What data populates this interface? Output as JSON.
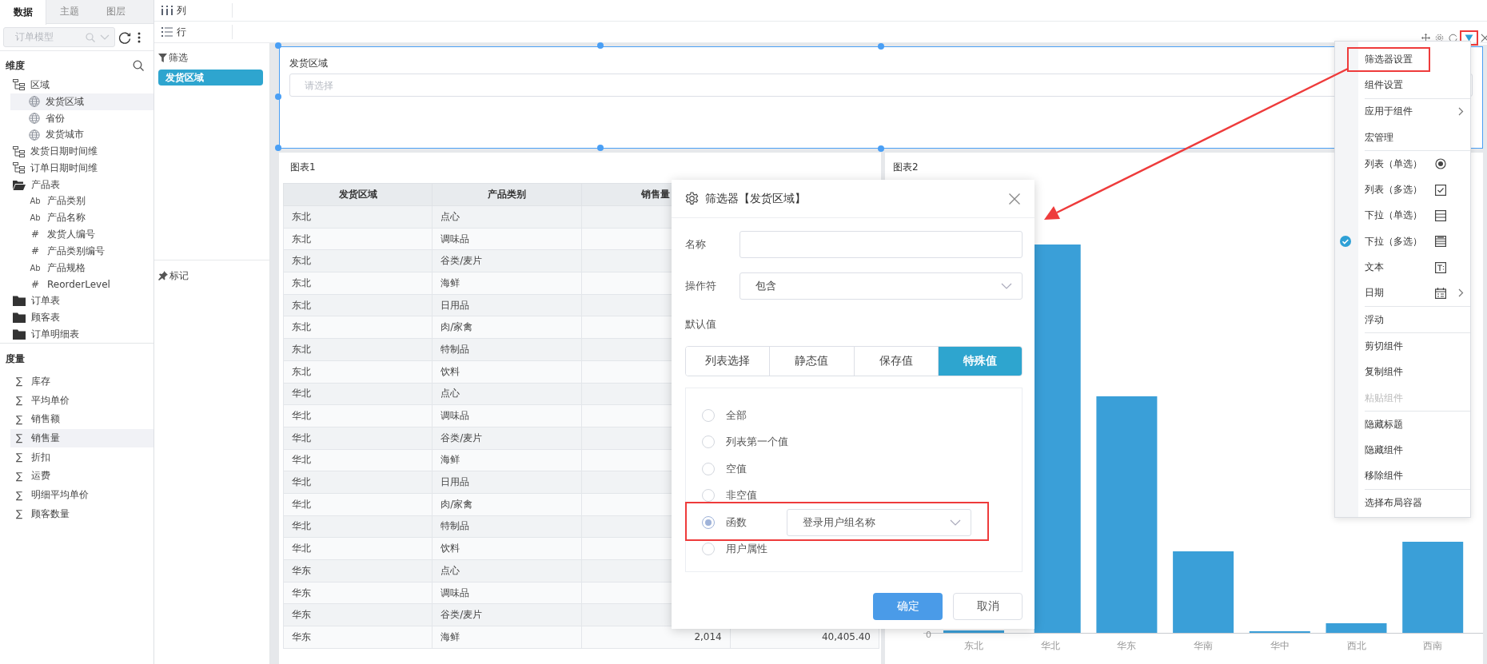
{
  "left_panel": {
    "tabs": [
      {
        "label": "数据",
        "selected": true
      },
      {
        "label": "主题",
        "selected": false
      },
      {
        "label": "图层",
        "selected": false
      }
    ],
    "model_select": {
      "value": "订单模型"
    },
    "dimensions": {
      "title": "维度",
      "items": [
        {
          "label": "区域",
          "kind": "hierarchy",
          "selected": false,
          "children": [
            {
              "label": "发货区域",
              "kind": "geo",
              "selected": true
            },
            {
              "label": "省份",
              "kind": "geo",
              "selected": false
            },
            {
              "label": "发货城市",
              "kind": "geo",
              "selected": false
            }
          ]
        },
        {
          "label": "发货日期时间维",
          "kind": "hierarchy",
          "selected": false
        },
        {
          "label": "订单日期时间维",
          "kind": "hierarchy",
          "selected": false
        },
        {
          "label": "产品表",
          "kind": "folder-open",
          "selected": false,
          "children": [
            {
              "label": "产品类别",
              "kind": "text",
              "glyph": "Ab",
              "selected": false
            },
            {
              "label": "产品名称",
              "kind": "text",
              "glyph": "Ab",
              "selected": false
            },
            {
              "label": "发货人编号",
              "kind": "number",
              "glyph": "#",
              "selected": false
            },
            {
              "label": "产品类别编号",
              "kind": "number",
              "glyph": "#",
              "selected": false
            },
            {
              "label": "产品规格",
              "kind": "text",
              "glyph": "Ab",
              "selected": false
            },
            {
              "label": "ReorderLevel",
              "kind": "number",
              "glyph": "#",
              "selected": false
            }
          ]
        },
        {
          "label": "订单表",
          "kind": "folder",
          "selected": false
        },
        {
          "label": "顾客表",
          "kind": "folder",
          "selected": false
        },
        {
          "label": "订单明细表",
          "kind": "folder",
          "selected": false
        }
      ]
    },
    "measures": {
      "title": "度量",
      "items": [
        {
          "label": "库存",
          "glyph": "∑",
          "selected": false
        },
        {
          "label": "平均单价",
          "glyph": "∑",
          "selected": false
        },
        {
          "label": "销售额",
          "glyph": "∑",
          "selected": false
        },
        {
          "label": "销售量",
          "glyph": "∑",
          "selected": true
        },
        {
          "label": "折扣",
          "glyph": "∑",
          "selected": false
        },
        {
          "label": "运费",
          "glyph": "∑",
          "selected": false
        },
        {
          "label": "明细平均单价",
          "glyph": "∑",
          "selected": false
        },
        {
          "label": "顾客数量",
          "glyph": "∑",
          "selected": false
        }
      ]
    }
  },
  "shelves": {
    "columns_label": "列",
    "rows_label": "行",
    "filter_label": "筛选",
    "filter_chips": [
      "发货区域"
    ],
    "marks_label": "标记"
  },
  "filter_widget": {
    "title": "发货区域",
    "placeholder": "请选择"
  },
  "chart1": {
    "title": "图表1",
    "columns": [
      "发货区域",
      "产品类别",
      "销售量"
    ],
    "rows": [
      {
        "cells": [
          "东北",
          "点心"
        ]
      },
      {
        "cells": [
          "东北",
          "调味品"
        ]
      },
      {
        "cells": [
          "东北",
          "谷类/麦片"
        ]
      },
      {
        "cells": [
          "东北",
          "海鲜"
        ]
      },
      {
        "cells": [
          "东北",
          "日用品"
        ]
      },
      {
        "cells": [
          "东北",
          "肉/家禽"
        ]
      },
      {
        "cells": [
          "东北",
          "特制品"
        ]
      },
      {
        "cells": [
          "东北",
          "饮料"
        ]
      },
      {
        "cells": [
          "华北",
          "点心"
        ]
      },
      {
        "cells": [
          "华北",
          "调味品"
        ]
      },
      {
        "cells": [
          "华北",
          "谷类/麦片"
        ]
      },
      {
        "cells": [
          "华北",
          "海鲜"
        ]
      },
      {
        "cells": [
          "华北",
          "日用品"
        ]
      },
      {
        "cells": [
          "华北",
          "肉/家禽"
        ]
      },
      {
        "cells": [
          "华北",
          "特制品"
        ]
      },
      {
        "cells": [
          "华北",
          "饮料"
        ]
      },
      {
        "cells": [
          "华东",
          "点心"
        ]
      },
      {
        "cells": [
          "华东",
          "调味品"
        ]
      },
      {
        "cells": [
          "华东",
          "谷类/麦片"
        ]
      },
      {
        "cells": [
          "华东",
          "海鲜",
          "2,014",
          "40,405.40"
        ]
      }
    ]
  },
  "chart2": {
    "title": "图表2",
    "y_tick": "0",
    "categories": [
      "东北",
      "华北",
      "华东",
      "华南",
      "华中",
      "西北",
      "西南"
    ]
  },
  "dialog": {
    "title": "筛选器【发货区域】",
    "name_label": "名称",
    "operator_label": "操作符",
    "operator_value": "包含",
    "default_label": "默认值",
    "tabs": [
      {
        "label": "列表选择",
        "selected": false
      },
      {
        "label": "静态值",
        "selected": false
      },
      {
        "label": "保存值",
        "selected": false
      },
      {
        "label": "特殊值",
        "selected": true
      }
    ],
    "options": [
      {
        "label": "全部",
        "kind": "plain",
        "selected": false,
        "annotated": false
      },
      {
        "label": "列表第一个值",
        "kind": "plain",
        "selected": false,
        "annotated": false
      },
      {
        "label": "空值",
        "kind": "plain",
        "selected": false,
        "annotated": false
      },
      {
        "label": "非空值",
        "kind": "plain",
        "selected": false,
        "annotated": false
      },
      {
        "label": "函数",
        "kind": "function",
        "value": "登录用户组名称",
        "selected": true,
        "annotated": true
      },
      {
        "label": "用户属性",
        "kind": "plain",
        "selected": false,
        "annotated": false
      }
    ],
    "ok": "确定",
    "cancel": "取消"
  },
  "component_toolbar": [
    {
      "annotated": false
    },
    {
      "annotated": false
    },
    {
      "annotated": false
    },
    {
      "annotated": true
    },
    {
      "annotated": false
    }
  ],
  "context_menu": {
    "groups": [
      [
        {
          "label": "筛选器设置",
          "kind": "plain",
          "submenu": false,
          "checked": false,
          "disabled": false,
          "annotated": true
        },
        {
          "label": "组件设置",
          "kind": "plain",
          "submenu": false,
          "checked": false,
          "disabled": false,
          "annotated": false
        }
      ],
      [
        {
          "label": "应用于组件",
          "kind": "plain",
          "submenu": true,
          "checked": false,
          "disabled": false,
          "annotated": false
        },
        {
          "label": "宏管理",
          "kind": "plain",
          "submenu": false,
          "checked": false,
          "disabled": false,
          "annotated": false
        }
      ],
      [
        {
          "label": "列表（单选）",
          "kind": "radio",
          "submenu": false,
          "checked": false,
          "disabled": false,
          "annotated": false
        },
        {
          "label": "列表（多选）",
          "kind": "checkbox",
          "submenu": false,
          "checked": false,
          "disabled": false,
          "annotated": false
        },
        {
          "label": "下拉（单选）",
          "kind": "dropdown-single",
          "submenu": false,
          "checked": false,
          "disabled": false,
          "annotated": false
        },
        {
          "label": "下拉（多选）",
          "kind": "dropdown-multi",
          "submenu": false,
          "checked": true,
          "disabled": false,
          "annotated": false
        },
        {
          "label": "文本",
          "kind": "text",
          "submenu": false,
          "checked": false,
          "disabled": false,
          "annotated": false
        },
        {
          "label": "日期",
          "kind": "calendar",
          "submenu": true,
          "checked": false,
          "disabled": false,
          "annotated": false
        }
      ],
      [
        {
          "label": "浮动",
          "kind": "plain",
          "submenu": false,
          "checked": false,
          "disabled": false,
          "annotated": false
        }
      ],
      [
        {
          "label": "剪切组件",
          "kind": "plain",
          "submenu": false,
          "checked": false,
          "disabled": false,
          "annotated": false
        },
        {
          "label": "复制组件",
          "kind": "plain",
          "submenu": false,
          "checked": false,
          "disabled": false,
          "annotated": false
        },
        {
          "label": "粘贴组件",
          "kind": "plain",
          "submenu": false,
          "checked": false,
          "disabled": true,
          "annotated": false
        }
      ],
      [
        {
          "label": "隐藏标题",
          "kind": "plain",
          "submenu": false,
          "checked": false,
          "disabled": false,
          "annotated": false
        },
        {
          "label": "隐藏组件",
          "kind": "plain",
          "submenu": false,
          "checked": false,
          "disabled": false,
          "annotated": false
        },
        {
          "label": "移除组件",
          "kind": "plain",
          "submenu": false,
          "checked": false,
          "disabled": false,
          "annotated": false
        }
      ],
      [
        {
          "label": "选择布局容器",
          "kind": "plain",
          "submenu": false,
          "checked": false,
          "disabled": false,
          "annotated": false
        }
      ]
    ]
  },
  "annotation_arrow": true
}
